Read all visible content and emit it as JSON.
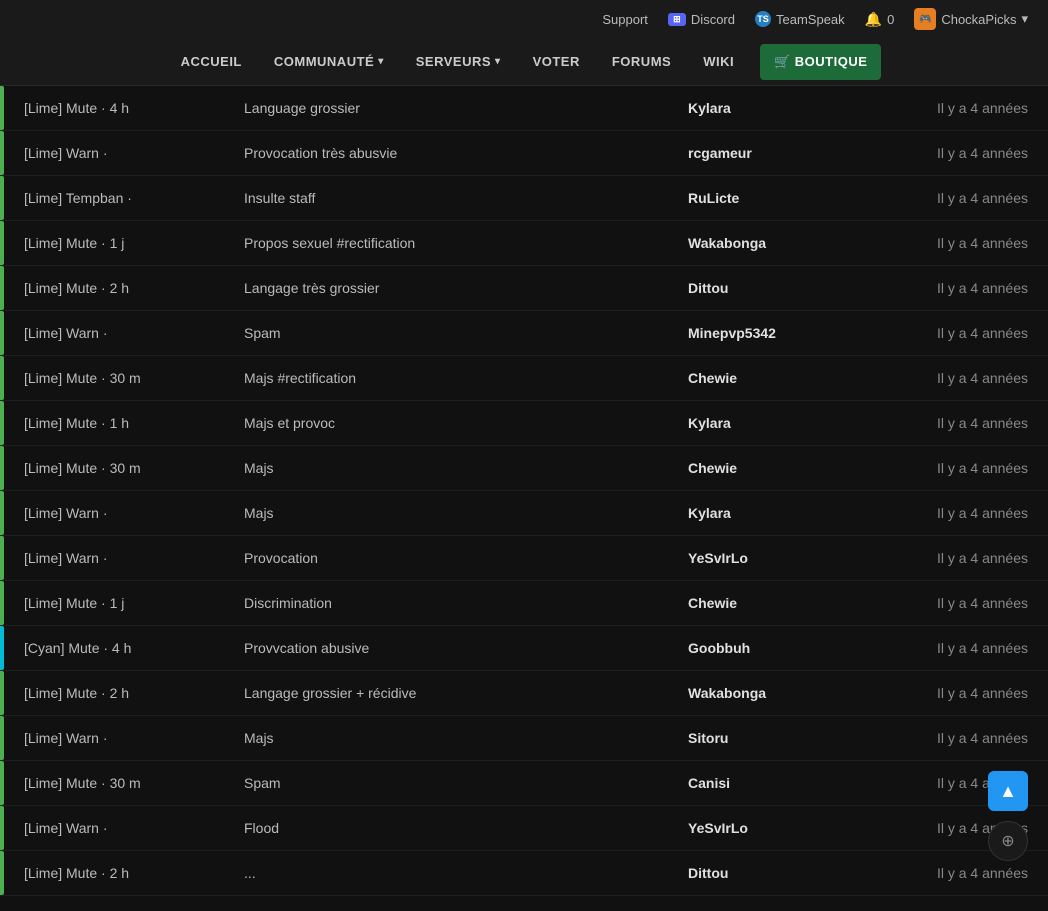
{
  "topbar": {
    "support_label": "Support",
    "discord_label": "Discord",
    "teamspeak_label": "TeamSpeak",
    "notifications_label": "0",
    "user_label": "ChockaPicks",
    "chevron_label": "▾"
  },
  "nav": {
    "items": [
      {
        "label": "ACCUEIL",
        "hasDropdown": false
      },
      {
        "label": "COMMUNAUTÉ",
        "hasDropdown": true
      },
      {
        "label": "SERVEURS",
        "hasDropdown": true
      },
      {
        "label": "VOTER",
        "hasDropdown": false
      },
      {
        "label": "FORUMS",
        "hasDropdown": false
      },
      {
        "label": "WIKI",
        "hasDropdown": false
      },
      {
        "label": "🛒 BOUTIQUE",
        "hasDropdown": false,
        "highlight": true
      }
    ]
  },
  "rows": [
    {
      "action": "[Lime] Mute · 4 h",
      "reason": "Language grossier",
      "player": "Kylara",
      "time": "Il y a 4 années",
      "accent": "green"
    },
    {
      "action": "[Lime] Warn ·",
      "reason": "Provocation très abusvie",
      "player": "rcgameur",
      "time": "Il y a 4 années",
      "accent": "green"
    },
    {
      "action": "[Lime] Tempban ·",
      "reason": "Insulte staff",
      "player": "RuLicte",
      "time": "Il y a 4 années",
      "accent": "green"
    },
    {
      "action": "[Lime] Mute · 1 j",
      "reason": "Propos sexuel #rectification",
      "player": "Wakabonga",
      "time": "Il y a 4 années",
      "accent": "green"
    },
    {
      "action": "[Lime] Mute · 2 h",
      "reason": "Langage très grossier",
      "player": "Dittou",
      "time": "Il y a 4 années",
      "accent": "green"
    },
    {
      "action": "[Lime] Warn ·",
      "reason": "Spam",
      "player": "Minepvp5342",
      "time": "Il y a 4 années",
      "accent": "green"
    },
    {
      "action": "[Lime] Mute · 30 m",
      "reason": "Majs #rectification",
      "player": "Chewie",
      "time": "Il y a 4 années",
      "accent": "green"
    },
    {
      "action": "[Lime] Mute · 1 h",
      "reason": "Majs et provoc",
      "player": "Kylara",
      "time": "Il y a 4 années",
      "accent": "green"
    },
    {
      "action": "[Lime] Mute · 30 m",
      "reason": "Majs",
      "player": "Chewie",
      "time": "Il y a 4 années",
      "accent": "green"
    },
    {
      "action": "[Lime] Warn ·",
      "reason": "Majs",
      "player": "Kylara",
      "time": "Il y a 4 années",
      "accent": "green"
    },
    {
      "action": "[Lime] Warn ·",
      "reason": "Provocation",
      "player": "YeSvIrLo",
      "time": "Il y a 4 années",
      "accent": "green"
    },
    {
      "action": "[Lime] Mute · 1 j",
      "reason": "Discrimination",
      "player": "Chewie",
      "time": "Il y a 4 années",
      "accent": "green"
    },
    {
      "action": "[Cyan] Mute · 4 h",
      "reason": "Provvcation abusive",
      "player": "Goobbuh",
      "time": "Il y a 4 années",
      "accent": "cyan"
    },
    {
      "action": "[Lime] Mute · 2 h",
      "reason": "Langage grossier + récidive",
      "player": "Wakabonga",
      "time": "Il y a 4 années",
      "accent": "green"
    },
    {
      "action": "[Lime] Warn ·",
      "reason": "Majs",
      "player": "Sitoru",
      "time": "Il y a 4 années",
      "accent": "green"
    },
    {
      "action": "[Lime] Mute · 30 m",
      "reason": "Spam",
      "player": "Canisi",
      "time": "Il y a 4 années",
      "accent": "green"
    },
    {
      "action": "[Lime] Warn ·",
      "reason": "Flood",
      "player": "YeSvIrLo",
      "time": "Il y a 4 années",
      "accent": "green"
    },
    {
      "action": "[Lime] Mute · 2 h",
      "reason": "...",
      "player": "Dittou",
      "time": "Il y a 4 années",
      "accent": "green"
    }
  ],
  "buttons": {
    "scroll_top_icon": "▲",
    "zoom_icon": "🔍"
  }
}
